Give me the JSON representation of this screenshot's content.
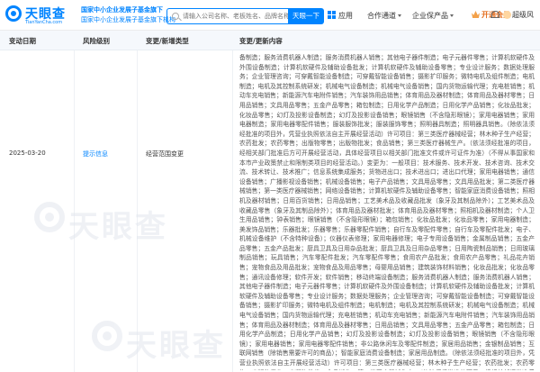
{
  "header": {
    "logo_text": "天眼查",
    "logo_sub": "TianYanCha.com",
    "slogan_line1": "国家中小企业发展子基金旗下",
    "slogan_line2": "国家中小企业发展子基金旗下机构",
    "search_placeholder": "请输入公司名称、老板姓名、品牌名称等",
    "search_button": "天眼一下",
    "nav": [
      "应用",
      "合作通道",
      "企业保产品"
    ],
    "vip_label": "开通会员",
    "user_label": "超级风"
  },
  "table": {
    "columns": [
      "变动日期",
      "风险级别",
      "变更/新增类型",
      "变更/更新内容"
    ],
    "row": {
      "date": "2025-03-20",
      "risk": "提示信息",
      "type": "经营范围变更",
      "detail": "备制造；服务消费机器人制造；服务消费机器人销售；其他电子器件制造；电子元器件零售；计算机软硬件及外围设备制造；计算机软硬件及辅助设备批发；计算机软硬件及辅助设备零售；专业设计服务；数据处理服务；企业管理咨询；可穿戴智能设备制造；可穿戴智能设备销售；摄影扩印服务；微特电机及组件制造；电机制造；电机及其控制系统研发；机械电气设备制造；机械电气设备销售；国内货物运输代理；充电桩销售；机动车充电销售；新能源汽车电附件销售；汽车装饰用品销售；体育用品及器材制造；体育用品及器材零售；日用品销售；文具用品零售；五金产品零售；箱包制造；日用化学产品制造；日用化学产品销售；化妆品批发；化妆品零售；幻灯及投影设备制造；幻灯及投影设备销售；眼镜销售（不含隐形眼镜）；家用电器销售；家用电器制造；家用电器零配件销售；服装服饰批发；服装服饰零售；照明器具制造；照明器具销售。（除依法须经批准的项目外，凭营业执照依法自主开展经营活动）许可项目：第三类医疗器械经营；林木种子生产经营；农药批发；农药零售；出版物零售；出版物批发；食品销售；第三类医疗器械生产。（依法须经批准的项目，经相关部门批准后方可开展经营活动，具体经营项目以相关部门批准文件或许可证件为准）（不得从事国家和本市产业政策禁止和限制类项目的经营活动。）变更为：一般项目：技术服务、技术开发、技术咨询、技术交流、技术转让、技术推广；信息系统集成服务；货物进出口；技术进出口；进出口代理；家用电器销售；通信设备销售；广播影视设备销售；机械设备销售；电子产品销售；文具用品零售；文具用品批发；第二类医疗器械销售；第一类医疗器械销售；网络设备销售；计算机软硬件及辅助设备零售；智能家庭消费设备销售；照相机及器材销售；日用百货销售；日用品销售；工艺美术品及收藏品批发（象牙及其制品除外）；工艺美术品及收藏品零售（象牙及其制品除外）；体育用品及器材批发；体育用品及器材零售；照相机及器材制造；个人卫生用品销售；钟表销售；眼镜销售（不含隐形眼镜）；箱包销售；化妆品批发；化妆品零售；家用电器制造；美发饰品销售；乐器批发；乐器零售；乐器零配件销售；自行车及零配件零售；自行车及零配件批发；电子、机械设备维护（不含特种设备）；仪器仪表修理；家用电器修理；电子专用设备销售；金属制品销售；五金产品零售；五金产品批发；厨具卫具及日用杂品批发；厨具卫具及日用杂品零售；日用陶瓷制品销售；日用玻璃制品销售；玩具销售；汽车零配件批发；汽车零配件零售；食用农产品批发；食用农产品零售；礼品花卉销售；宠物食品及用品批发；宠物食品及用品零售；母婴用品销售；建筑装饰材料销售；化妆品批发；化妆品零售；通讯设备修理；软件开发；软件销售；移动终端设备制造；服务消费机器人制造；服务消费机器人销售；其他电子器件制造；电子元器件零售；计算机软硬件及外围设备制造；计算机软硬件及辅助设备批发；计算机软硬件及辅助设备零售；专业设计服务；数据处理服务；企业管理咨询；可穿戴智能设备制造；可穿戴智能设备销售；摄影扩印服务；微特电机及组件制造；电机制造；电机及其控制系统研发；机械电气设备制造；机械电气设备销售；国内货物运输代理；充电桩销售；机动车充电销售；新能源汽车电附件销售；汽车装饰用品销售；体育用品及器材制造；体育用品及器材零售；日用品销售；文具用品零售；五金产品零售；箱包制造；日用化学产品制造；日用化学产品销售；幻灯及投影设备制造；幻灯及投影设备销售；眼镜销售（不含隐形眼镜）；家用电器销售；家用电器零配件销售；非公路休闲车及零配件制造；家居用品销售；金银制品销售；互联网销售（除销售需要许可的商品）；智能家庭消费设备制造；家居用品制造。（除依法须经批准的项目外，凭营业执照依法自主开展经营活动）许可项目：第三类医疗器械经营；林木种子生产经营；农药批发；农药零售；出版物零售；出版物批发；食品销售；第三类医疗器械生产。（依法须经批准的项目，经相关部门批准后方可开展经营活动，具体经营项目以相关部门批准文件或许可证件为准）（不得从事国家和本市产业政策禁止和限制类项目的经营活动。）"
    }
  },
  "watermark_text": "天眼查"
}
